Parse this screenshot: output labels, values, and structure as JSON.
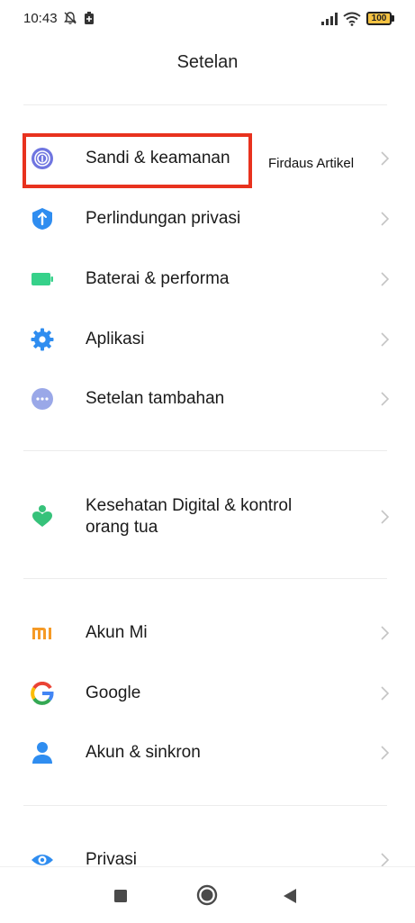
{
  "status_bar": {
    "time": "10:43",
    "battery_level": "100"
  },
  "header": {
    "title": "Setelan"
  },
  "watermark": "Firdaus Artikel",
  "groups": [
    {
      "items": [
        {
          "label": "Sandi & keamanan",
          "icon": "fingerprint-icon",
          "color": "#6f75e0"
        },
        {
          "label": "Perlindungan privasi",
          "icon": "shield-icon",
          "color": "#2f8df0"
        },
        {
          "label": "Baterai & performa",
          "icon": "battery-icon",
          "color": "#36d18a"
        },
        {
          "label": "Aplikasi",
          "icon": "gear-icon",
          "color": "#2f8df0"
        },
        {
          "label": "Setelan tambahan",
          "icon": "more-icon",
          "color": "#9aa8e8"
        }
      ]
    },
    {
      "items": [
        {
          "label_line1": "Kesehatan Digital & kontrol",
          "label_line2": "orang tua",
          "icon": "wellbeing-icon",
          "color": "#36c27a"
        }
      ]
    },
    {
      "items": [
        {
          "label": "Akun Mi",
          "icon": "mi-icon",
          "color": "#f59a26"
        },
        {
          "label": "Google",
          "icon": "google-icon",
          "color": "#4285f4"
        },
        {
          "label": "Akun & sinkron",
          "icon": "person-icon",
          "color": "#2f8df0"
        }
      ]
    },
    {
      "items": [
        {
          "label": "Privasi",
          "icon": "eye-icon",
          "color": "#2f8df0"
        }
      ]
    }
  ]
}
